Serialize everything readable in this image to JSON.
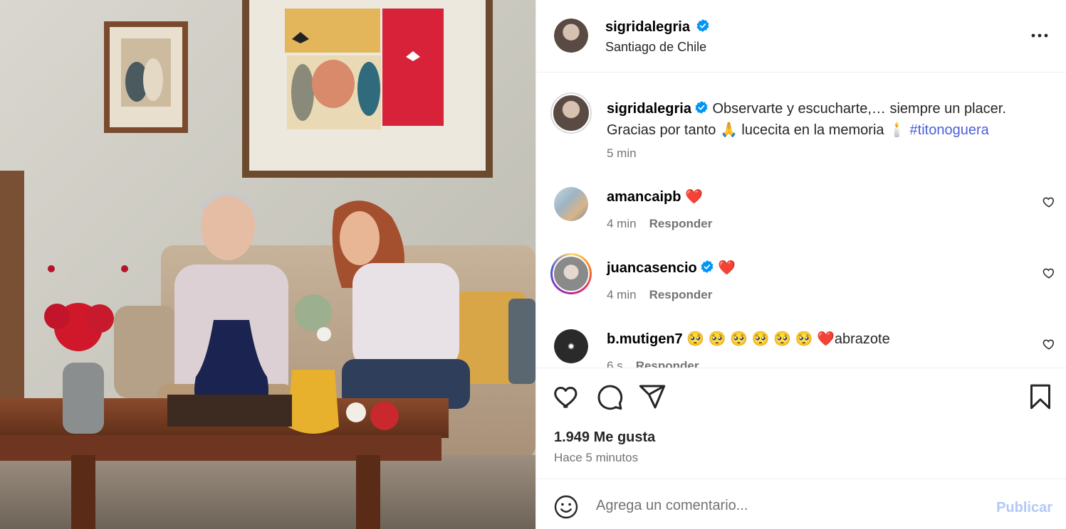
{
  "post": {
    "author": "sigridalegria",
    "location": "Santiago de Chile",
    "verified": true,
    "caption_text": "Observarte y escucharte,… siempre un placer.",
    "caption_line2": "Gracias por tanto 🙏 lucecita en la memoria 🕯️",
    "caption_hashtag": "#titonoguera",
    "caption_time": "5 min"
  },
  "comments": [
    {
      "user": "amancaipb",
      "verified": false,
      "text": "❤️",
      "time": "4 min",
      "reply_label": "Responder",
      "story_ring": false
    },
    {
      "user": "juancasencio",
      "verified": true,
      "text": "❤️",
      "time": "4 min",
      "reply_label": "Responder",
      "story_ring": true
    },
    {
      "user": "b.mutigen7",
      "verified": false,
      "text": "🥺 🥺 🥺 🥺 🥺 🥺 ❤️abrazote",
      "time": "6 s",
      "reply_label": "Responder",
      "story_ring": false
    }
  ],
  "actions": {
    "likes": "1.949 Me gusta",
    "time_ago": "Hace 5 minutos"
  },
  "compose": {
    "placeholder": "Agrega un comentario...",
    "publish_label": "Publicar"
  },
  "colors": {
    "link": "#4c5fd7",
    "verified": "#0095f6",
    "publish_disabled": "#b2c8f7",
    "heart_red": "#ff3040"
  },
  "icons": [
    "verified-badge-icon",
    "more-options-icon",
    "heart-icon",
    "comment-icon",
    "share-icon",
    "bookmark-icon",
    "emoji-icon"
  ]
}
